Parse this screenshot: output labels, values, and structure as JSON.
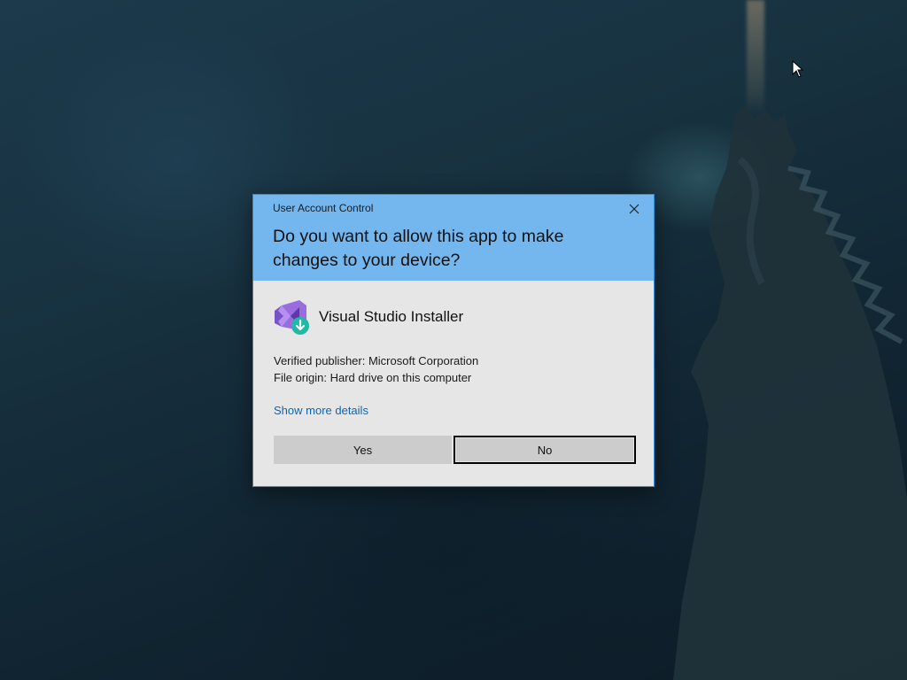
{
  "dialog": {
    "caption": "User Account Control",
    "question": "Do you want to allow this app to make changes to your device?",
    "app_name": "Visual Studio Installer",
    "publisher": "Verified publisher: Microsoft Corporation",
    "origin": "File origin: Hard drive on this computer",
    "more_details": "Show more details",
    "yes_label": "Yes",
    "no_label": "No",
    "close_icon": "close-icon",
    "app_icon": "visual-studio-installer-icon"
  },
  "colors": {
    "header_bg": "#74b7ee",
    "body_bg": "#e6e6e6",
    "link": "#0a66b5",
    "button_bg": "#cccccc",
    "dialog_border": "#2b8cd8"
  }
}
